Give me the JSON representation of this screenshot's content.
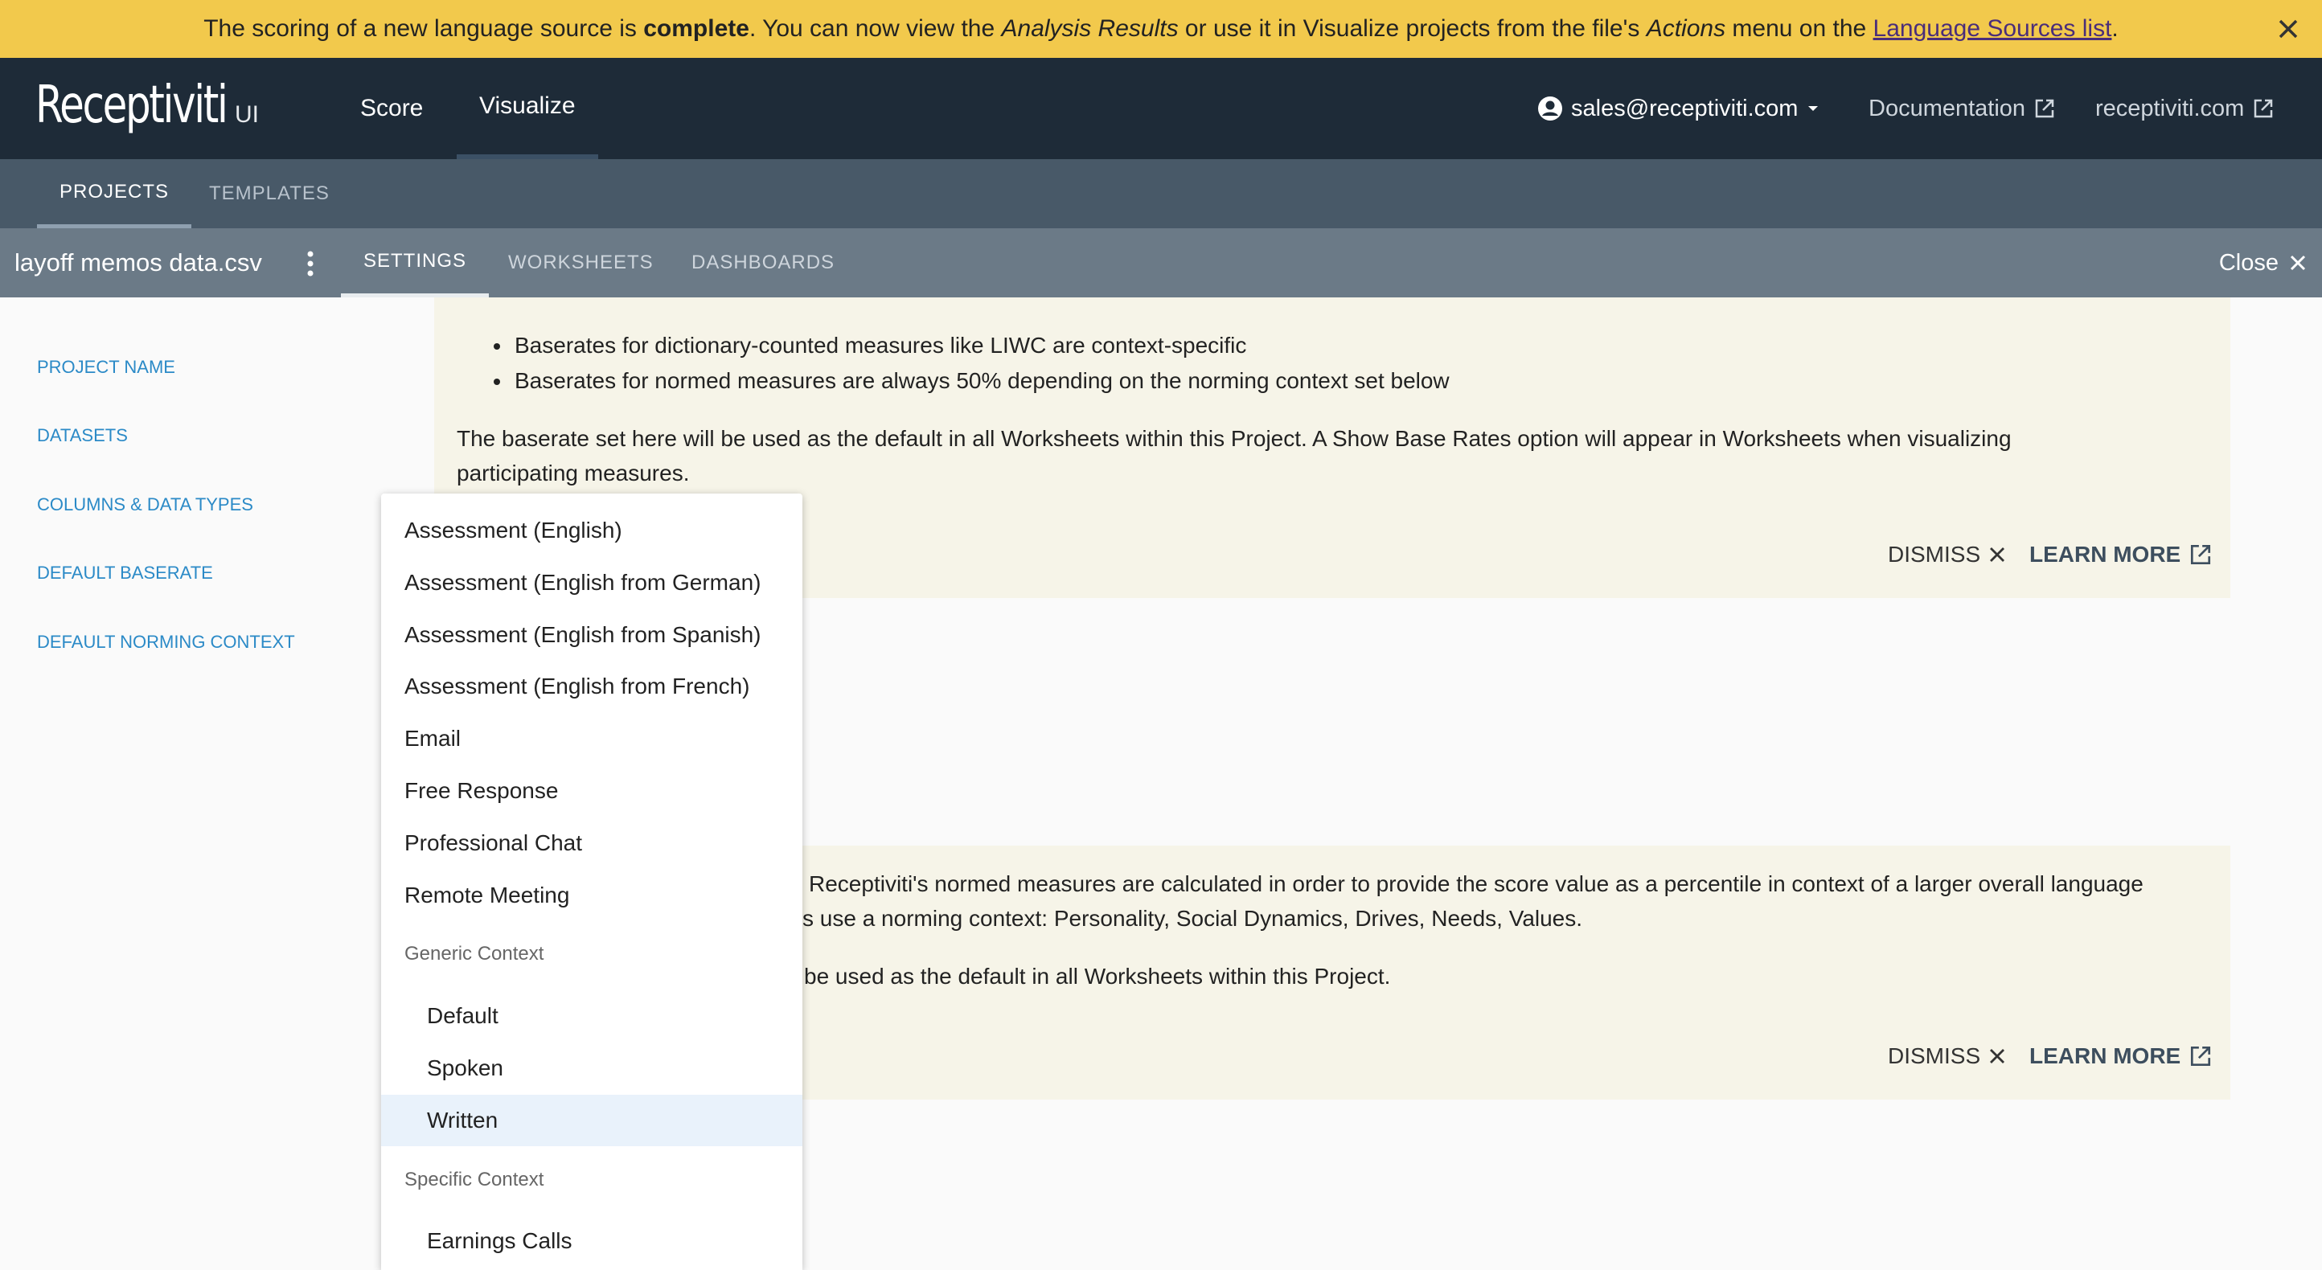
{
  "banner": {
    "part1": "The scoring of a new language source is ",
    "bold": "complete",
    "part2": ". You can now view the ",
    "italic1": "Analysis Results",
    "part3": " or use it in Visualize projects from the file's ",
    "italic2": "Actions",
    "part4": " menu on the ",
    "link": "Language Sources list",
    "part5": "."
  },
  "header": {
    "logo": "Receptiviti",
    "logo_suffix": "UI",
    "nav": [
      "Score",
      "Visualize"
    ],
    "account": "sales@receptiviti.com",
    "docs": "Documentation",
    "site": "receptiviti.com"
  },
  "subnav": {
    "projects": "PROJECTS",
    "templates": "TEMPLATES"
  },
  "project": {
    "name": "layoff memos data.csv",
    "tabs": [
      "SETTINGS",
      "WORKSHEETS",
      "DASHBOARDS"
    ],
    "close": "Close"
  },
  "sidebar": {
    "items": [
      "PROJECT NAME",
      "DATASETS",
      "COLUMNS & DATA TYPES",
      "DEFAULT BASERATE",
      "DEFAULT NORMING CONTEXT"
    ]
  },
  "baserate_card": {
    "bullet1": "Baserates for dictionary-counted measures like LIWC are context-specific",
    "bullet2": "Baserates for normed measures are always 50% depending on the norming context set below",
    "para1": "The baserate set here will be used as the default in all Worksheets within this Project. A Show Base Rates option will appear in Worksheets when visualizing",
    "para2": "participating measures.",
    "dismiss": "DISMISS",
    "learn": "LEARN MORE"
  },
  "norming_card": {
    "line1": "Receptiviti's normed measures are calculated in order to provide the score value as a percentile in context of a larger overall language",
    "line2": "s use a norming context: Personality, Social Dynamics, Drives, Needs, Values.",
    "line3": "be used as the default in all Worksheets within this Project.",
    "dismiss": "DISMISS",
    "learn": "LEARN MORE"
  },
  "dropdown": {
    "options_top": [
      "Assessment (English)",
      "Assessment (English from German)",
      "Assessment (English from Spanish)",
      "Assessment (English from French)",
      "Email",
      "Free Response",
      "Professional Chat",
      "Remote Meeting"
    ],
    "group_generic": "Generic Context",
    "generic": [
      "Default",
      "Spoken",
      "Written"
    ],
    "selected": "Written",
    "group_specific": "Specific Context",
    "specific": [
      "Earnings Calls"
    ]
  },
  "colors": {
    "banner": "#f2c94c",
    "topnav": "#1e2b38",
    "subnav": "#485968",
    "projbar": "#6b7a87",
    "link": "#2b8ac7",
    "card": "#f6f4e8",
    "selected": "#e9f2fb"
  },
  "icons": [
    "close-icon",
    "account-circle-icon",
    "caret-down-icon",
    "external-link-icon",
    "kebab-menu-icon"
  ]
}
